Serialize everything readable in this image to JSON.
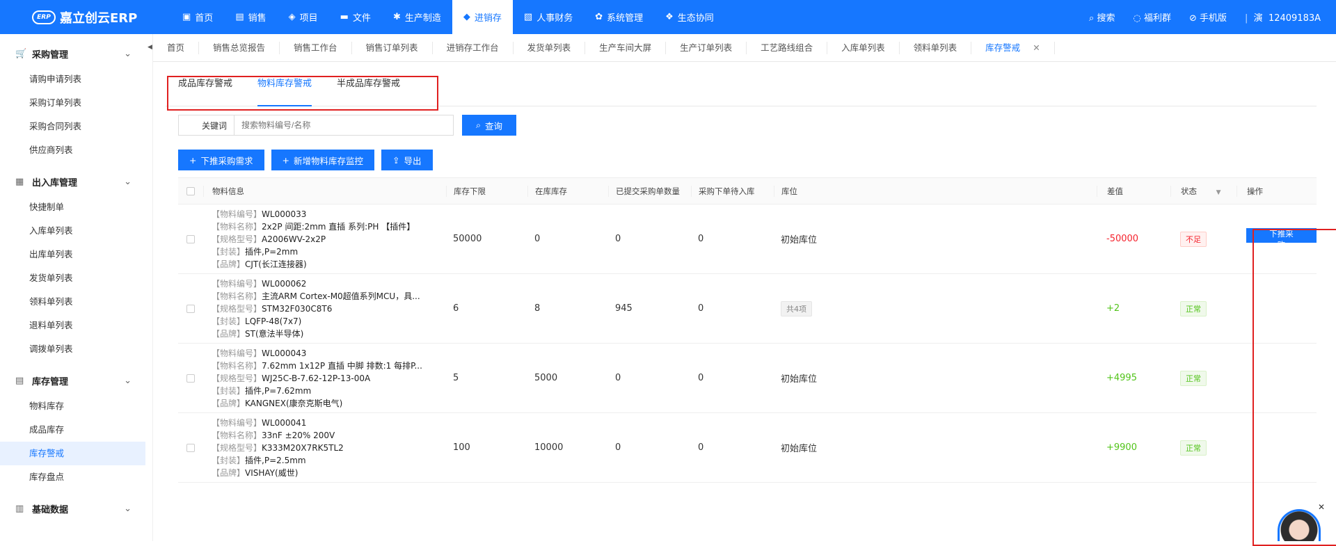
{
  "brand": {
    "badge": "ERP",
    "name": "嘉立创云ERP"
  },
  "nav": [
    {
      "icon": "monitor-icon",
      "glyph": "▣",
      "label": "首页"
    },
    {
      "icon": "cart-icon",
      "glyph": "▤",
      "label": "销售"
    },
    {
      "icon": "layers-icon",
      "glyph": "◈",
      "label": "项目"
    },
    {
      "icon": "folder-icon",
      "glyph": "▬",
      "label": "文件"
    },
    {
      "icon": "gear-icon",
      "glyph": "✱",
      "label": "生产制造"
    },
    {
      "icon": "box-icon",
      "glyph": "◆",
      "label": "进销存",
      "active": true
    },
    {
      "icon": "idcard-icon",
      "glyph": "▧",
      "label": "人事财务"
    },
    {
      "icon": "settings-icon",
      "glyph": "✿",
      "label": "系统管理"
    },
    {
      "icon": "cluster-icon",
      "glyph": "❖",
      "label": "生态协同"
    }
  ],
  "top_right": {
    "search": "搜索",
    "welfare": "福利群",
    "mobile": "手机版",
    "user_short": "演",
    "user_id": "12409183A"
  },
  "sidebar": {
    "groups": [
      {
        "icon": "cart-icon",
        "glyph": "🛒",
        "label": "采购管理",
        "items": [
          {
            "label": "请购申请列表"
          },
          {
            "label": "采购订单列表"
          },
          {
            "label": "采购合同列表"
          },
          {
            "label": "供应商列表"
          }
        ]
      },
      {
        "icon": "warehouse-icon",
        "glyph": "▦",
        "label": "出入库管理",
        "items": [
          {
            "label": "快捷制单"
          },
          {
            "label": "入库单列表"
          },
          {
            "label": "出库单列表"
          },
          {
            "label": "发货单列表"
          },
          {
            "label": "领料单列表"
          },
          {
            "label": "退料单列表"
          },
          {
            "label": "调拨单列表"
          }
        ]
      },
      {
        "icon": "inventory-icon",
        "glyph": "▤",
        "label": "库存管理",
        "items": [
          {
            "label": "物料库存"
          },
          {
            "label": "成品库存"
          },
          {
            "label": "库存警戒",
            "active": true
          },
          {
            "label": "库存盘点"
          }
        ]
      },
      {
        "icon": "database-icon",
        "glyph": "▥",
        "label": "基础数据",
        "items": []
      }
    ]
  },
  "tabs": [
    {
      "label": "首页"
    },
    {
      "label": "销售总览报告"
    },
    {
      "label": "销售工作台"
    },
    {
      "label": "销售订单列表"
    },
    {
      "label": "进销存工作台"
    },
    {
      "label": "发货单列表"
    },
    {
      "label": "生产车间大屏"
    },
    {
      "label": "生产订单列表"
    },
    {
      "label": "工艺路线组合"
    },
    {
      "label": "入库单列表"
    },
    {
      "label": "领料单列表"
    },
    {
      "label": "库存警戒",
      "active": true,
      "closable": true
    }
  ],
  "subtabs": [
    {
      "label": "成品库存警戒"
    },
    {
      "label": "物料库存警戒",
      "active": true
    },
    {
      "label": "半成品库存警戒"
    }
  ],
  "search": {
    "label": "关键词",
    "placeholder": "搜索物料编号/名称",
    "button": "查询"
  },
  "actions": {
    "push_purchase": "下推采购需求",
    "add_monitor": "新增物料库存监控",
    "export": "导出"
  },
  "table": {
    "headers": {
      "info": "物料信息",
      "min": "库存下限",
      "stock": "在库库存",
      "submitted": "已提交采购单数量",
      "pending": "采购下单待入库",
      "location": "库位",
      "diff": "差值",
      "status": "状态",
      "ops": "操作"
    },
    "field_labels": {
      "code": "【物料编号】",
      "name": "【物料名称】",
      "spec": "【规格型号】",
      "pkg": "【封装】",
      "brand": "【品牌】"
    },
    "rows": [
      {
        "code": "WL000033",
        "name": "2x2P 间距:2mm 直插 系列:PH 【插件】",
        "spec": "A2006WV-2x2P",
        "pkg": "插件,P=2mm",
        "brand": "CJT(长江连接器)",
        "min": "50000",
        "stock": "0",
        "submitted": "0",
        "pending": "0",
        "location": "初始库位",
        "location_badge": false,
        "diff": "-50000",
        "diff_sign": "neg",
        "status": "不足",
        "status_type": "bad",
        "op": "下推采购"
      },
      {
        "code": "WL000062",
        "name": "主流ARM Cortex-M0超值系列MCU，具...",
        "spec": "STM32F030C8T6",
        "pkg": "LQFP-48(7x7)",
        "brand": "ST(意法半导体)",
        "min": "6",
        "stock": "8",
        "submitted": "945",
        "pending": "0",
        "location": "共4项",
        "location_badge": true,
        "diff": "+2",
        "diff_sign": "pos",
        "status": "正常",
        "status_type": "ok",
        "op": ""
      },
      {
        "code": "WL000043",
        "name": "7.62mm 1x12P 直插 中脚 排数:1 每排P...",
        "spec": "WJ25C-B-7.62-12P-13-00A",
        "pkg": "插件,P=7.62mm",
        "brand": "KANGNEX(康奈克斯电气)",
        "min": "5",
        "stock": "5000",
        "submitted": "0",
        "pending": "0",
        "location": "初始库位",
        "location_badge": false,
        "diff": "+4995",
        "diff_sign": "pos",
        "status": "正常",
        "status_type": "ok",
        "op": ""
      },
      {
        "code": "WL000041",
        "name": "33nF ±20% 200V",
        "spec": "K333M20X7RK5TL2",
        "pkg": "插件,P=2.5mm",
        "brand": "VISHAY(威世)",
        "min": "100",
        "stock": "10000",
        "submitted": "0",
        "pending": "0",
        "location": "初始库位",
        "location_badge": false,
        "diff": "+9900",
        "diff_sign": "pos",
        "status": "正常",
        "status_type": "ok",
        "op": ""
      }
    ]
  },
  "colors": {
    "primary": "#1677ff",
    "danger": "#f5222d",
    "success": "#52c41a",
    "highlight_box": "#e02020"
  }
}
